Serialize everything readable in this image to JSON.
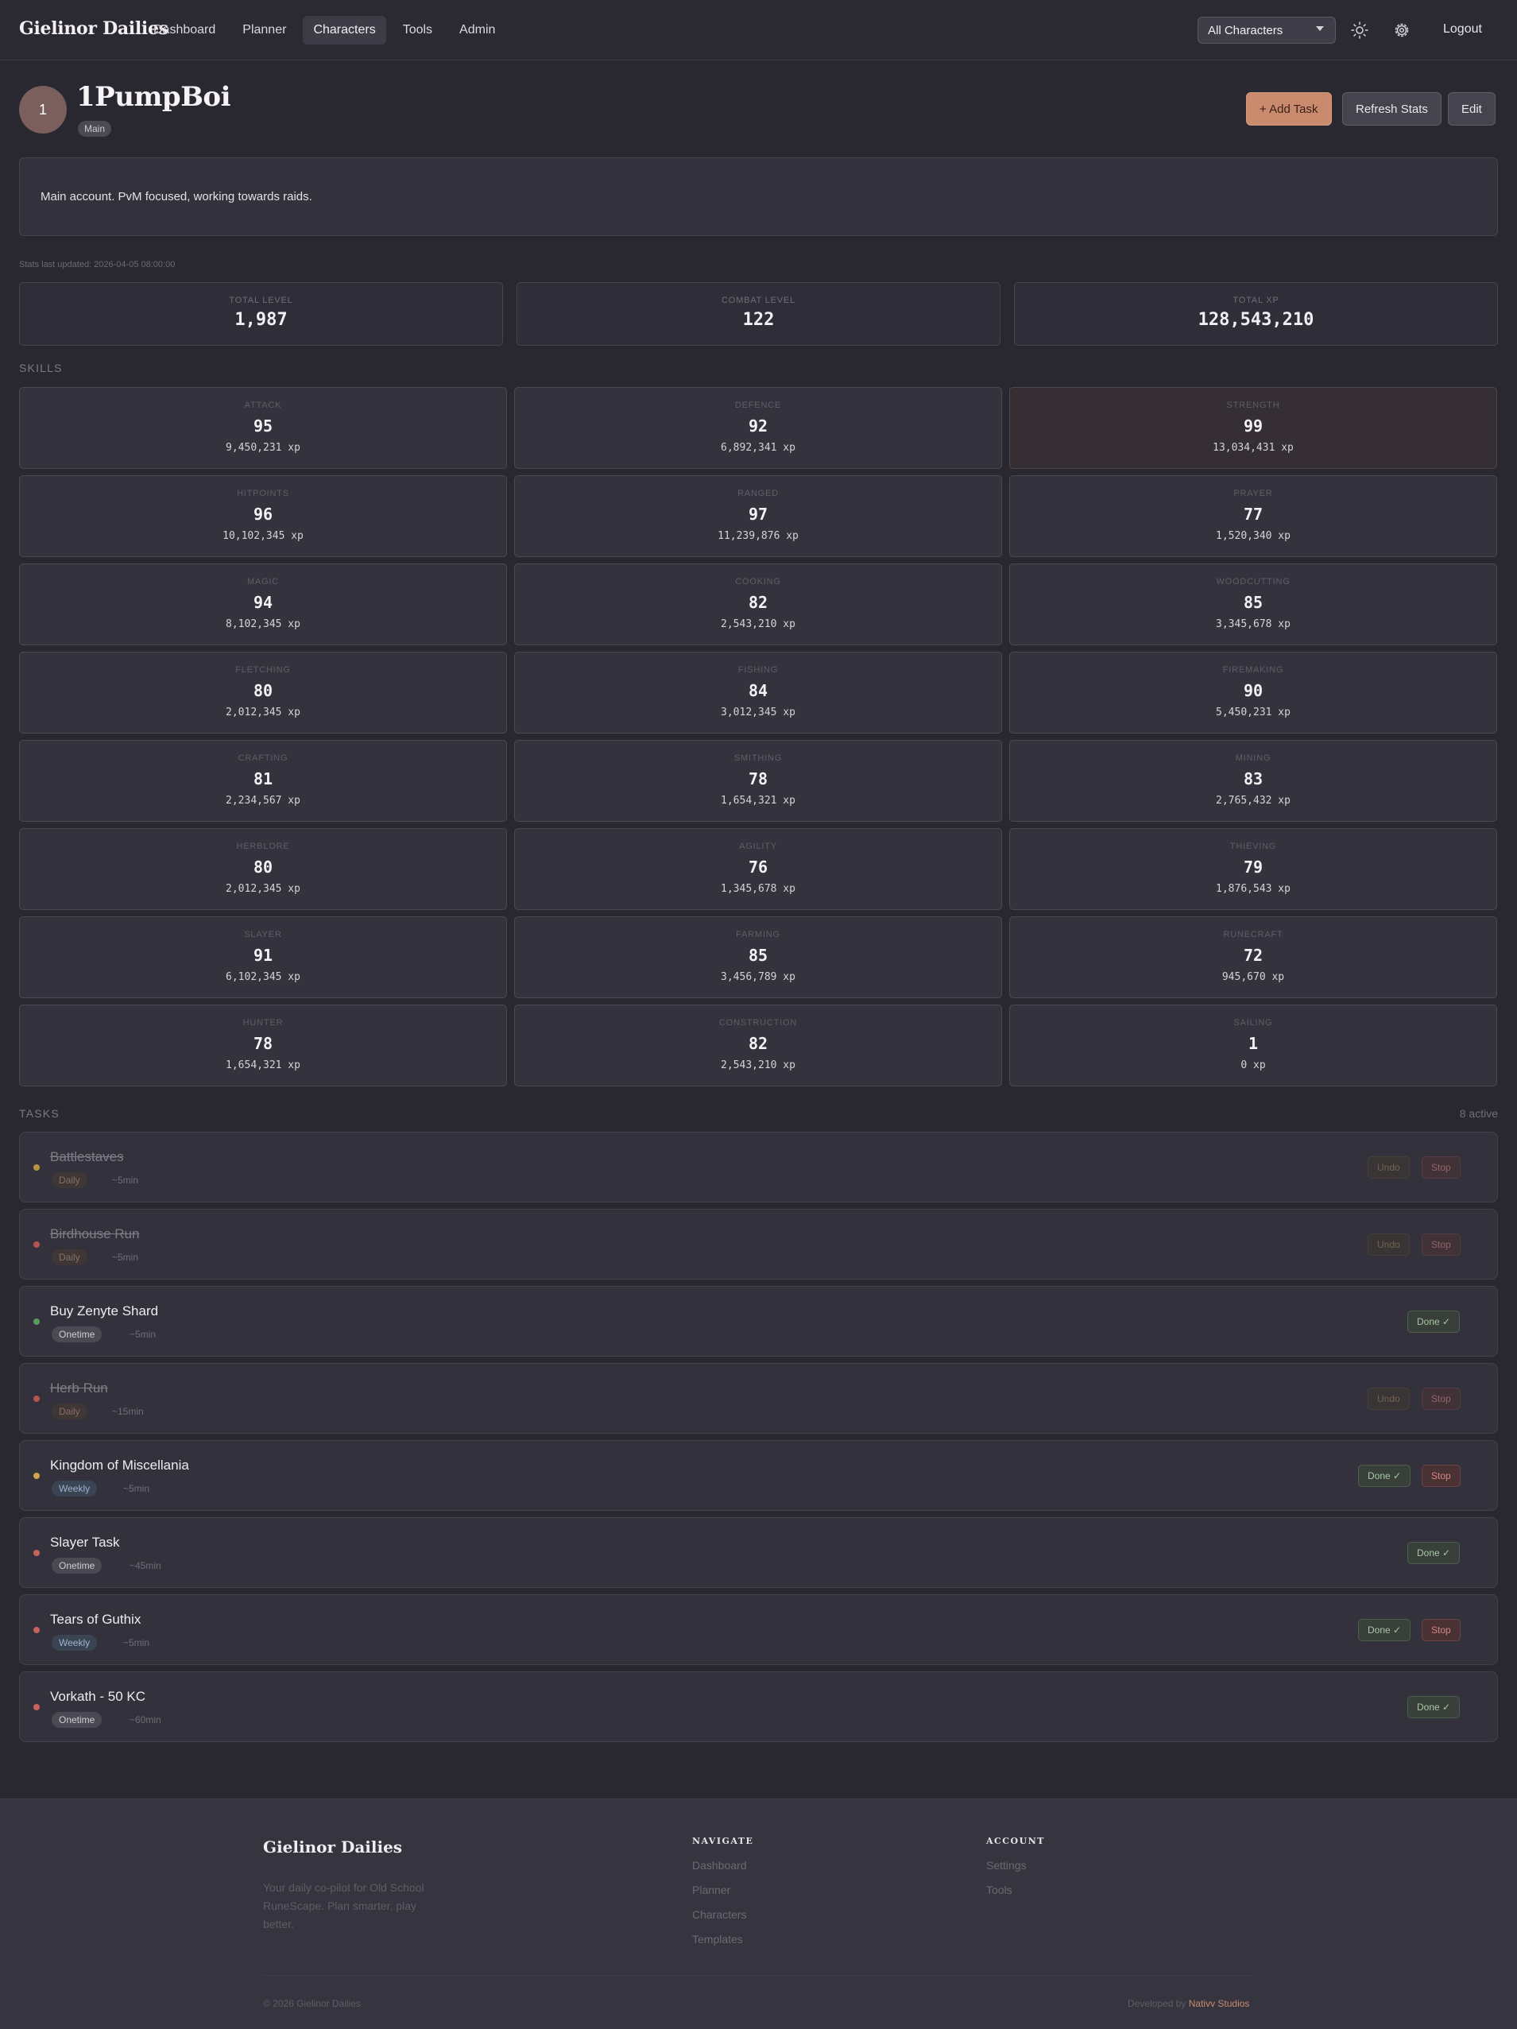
{
  "nav": {
    "brand": "Gielinor Dailies",
    "links": [
      "Dashboard",
      "Planner",
      "Characters",
      "Tools",
      "Admin"
    ],
    "active_link": "Characters",
    "character_select": "All Characters",
    "logout": "Logout"
  },
  "character": {
    "avatar_initial": "1",
    "name": "1PumpBoi",
    "badge": "Main",
    "notes": "Main account. PvM focused, working towards raids.",
    "stats_updated": "Stats last updated: 2026-04-05 08:00:00"
  },
  "actions": {
    "add_task": "+ Add Task",
    "refresh_stats": "Refresh Stats",
    "edit": "Edit"
  },
  "summary": [
    {
      "label": "TOTAL LEVEL",
      "value": "1,987"
    },
    {
      "label": "COMBAT LEVEL",
      "value": "122"
    },
    {
      "label": "TOTAL XP",
      "value": "128,543,210"
    }
  ],
  "skills_title": "SKILLS",
  "skills": [
    {
      "name": "ATTACK",
      "level": "95",
      "xp": "9,450,231 xp"
    },
    {
      "name": "DEFENCE",
      "level": "92",
      "xp": "6,892,341 xp"
    },
    {
      "name": "STRENGTH",
      "level": "99",
      "xp": "13,034,431 xp"
    },
    {
      "name": "HITPOINTS",
      "level": "96",
      "xp": "10,102,345 xp"
    },
    {
      "name": "RANGED",
      "level": "97",
      "xp": "11,239,876 xp"
    },
    {
      "name": "PRAYER",
      "level": "77",
      "xp": "1,520,340 xp"
    },
    {
      "name": "MAGIC",
      "level": "94",
      "xp": "8,102,345 xp"
    },
    {
      "name": "COOKING",
      "level": "82",
      "xp": "2,543,210 xp"
    },
    {
      "name": "WOODCUTTING",
      "level": "85",
      "xp": "3,345,678 xp"
    },
    {
      "name": "FLETCHING",
      "level": "80",
      "xp": "2,012,345 xp"
    },
    {
      "name": "FISHING",
      "level": "84",
      "xp": "3,012,345 xp"
    },
    {
      "name": "FIREMAKING",
      "level": "90",
      "xp": "5,450,231 xp"
    },
    {
      "name": "CRAFTING",
      "level": "81",
      "xp": "2,234,567 xp"
    },
    {
      "name": "SMITHING",
      "level": "78",
      "xp": "1,654,321 xp"
    },
    {
      "name": "MINING",
      "level": "83",
      "xp": "2,765,432 xp"
    },
    {
      "name": "HERBLORE",
      "level": "80",
      "xp": "2,012,345 xp"
    },
    {
      "name": "AGILITY",
      "level": "76",
      "xp": "1,345,678 xp"
    },
    {
      "name": "THIEVING",
      "level": "79",
      "xp": "1,876,543 xp"
    },
    {
      "name": "SLAYER",
      "level": "91",
      "xp": "6,102,345 xp"
    },
    {
      "name": "FARMING",
      "level": "85",
      "xp": "3,456,789 xp"
    },
    {
      "name": "RUNECRAFT",
      "level": "72",
      "xp": "945,670 xp"
    },
    {
      "name": "HUNTER",
      "level": "78",
      "xp": "1,654,321 xp"
    },
    {
      "name": "CONSTRUCTION",
      "level": "82",
      "xp": "2,543,210 xp"
    },
    {
      "name": "SAILING",
      "level": "1",
      "xp": "0 xp"
    }
  ],
  "tasks_title": "TASKS",
  "tasks_count": "8 active",
  "tasks": [
    {
      "title": "Battlestaves",
      "tag": "Daily",
      "estimate": "~5min",
      "done": true,
      "dot_color": "#b8923f",
      "buttons": [
        "Undo",
        "Stop"
      ]
    },
    {
      "title": "Birdhouse Run",
      "tag": "Daily",
      "estimate": "~5min",
      "done": true,
      "dot_color": "#b5534e",
      "buttons": [
        "Undo",
        "Stop"
      ]
    },
    {
      "title": "Buy Zenyte Shard",
      "tag": "Onetime",
      "estimate": "~5min",
      "done": false,
      "dot_color": "#5a9a5f",
      "buttons": [
        "Done ✓"
      ]
    },
    {
      "title": "Herb Run",
      "tag": "Daily",
      "estimate": "~15min",
      "done": true,
      "dot_color": "#b5534e",
      "buttons": [
        "Undo",
        "Stop"
      ]
    },
    {
      "title": "Kingdom of Miscellania",
      "tag": "Weekly",
      "estimate": "~5min",
      "done": false,
      "dot_color": "#c9a64a",
      "buttons": [
        "Done ✓",
        "Stop"
      ]
    },
    {
      "title": "Slayer Task",
      "tag": "Onetime",
      "estimate": "~45min",
      "done": false,
      "dot_color": "#c8625a",
      "buttons": [
        "Done ✓"
      ]
    },
    {
      "title": "Tears of Guthix",
      "tag": "Weekly",
      "estimate": "~5min",
      "done": false,
      "dot_color": "#c8625a",
      "buttons": [
        "Done ✓",
        "Stop"
      ]
    },
    {
      "title": "Vorkath - 50 KC",
      "tag": "Onetime",
      "estimate": "~60min",
      "done": false,
      "dot_color": "#c8625a",
      "buttons": [
        "Done ✓"
      ]
    }
  ],
  "footer": {
    "brand": "Gielinor Dailies",
    "description": "Your daily co-pilot for Old School RuneScape. Plan smarter, play better.",
    "navigate_title": "NAVIGATE",
    "navigate_links": [
      "Dashboard",
      "Planner",
      "Characters",
      "Templates"
    ],
    "account_title": "ACCOUNT",
    "account_links": [
      "Settings",
      "Tools"
    ],
    "copyright": "© 2026 Gielinor Dailies",
    "developed_by": "Developed by",
    "developer": "Nativv Studios"
  }
}
